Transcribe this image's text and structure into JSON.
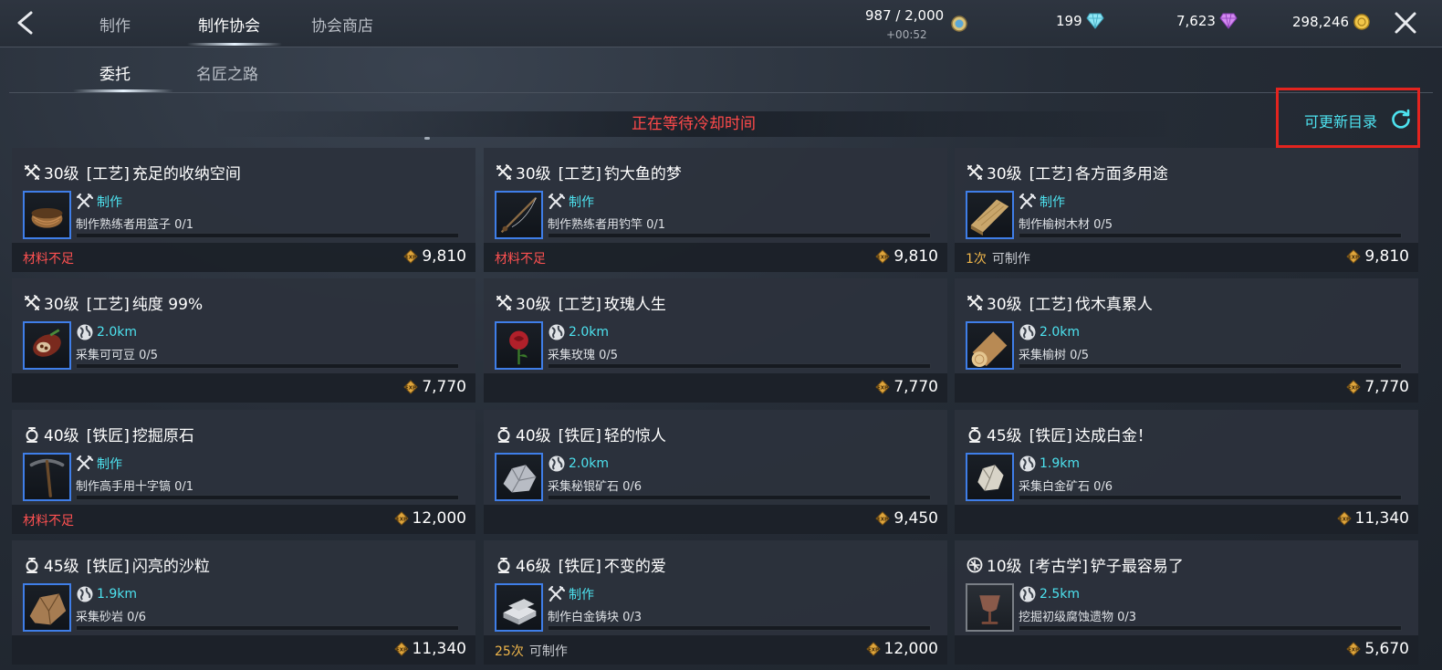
{
  "header": {
    "tabs": [
      "制作",
      "制作协会",
      "协会商店"
    ],
    "active_tab": "制作协会",
    "stamina": "987 / 2,000",
    "stamina_timer": "+00:52",
    "diamonds": "199",
    "gems": "7,623",
    "gold": "298,246"
  },
  "subtabs": [
    "委托",
    "名匠之路"
  ],
  "active_subtab": "委托",
  "cooldown_text": "正在等待冷却时间",
  "refresh_label": "可更新目录",
  "colors": {
    "accent": "#4de2ef",
    "warning": "#ff5151",
    "count": "#f0b64a",
    "highlight_box": "#e3241f"
  },
  "cards": [
    {
      "icon": "craft-icon",
      "level": "30级",
      "category": "[工艺]",
      "name": "充足的收纳空间",
      "tag_icon": "tools-icon",
      "tag": "制作",
      "desc": "制作熟练者用篮子 0/1",
      "status_type": "warn",
      "status": "材料不足",
      "count": "",
      "reward": "9,810",
      "thumb": "basket",
      "thumb_frame": "blue"
    },
    {
      "icon": "craft-icon",
      "level": "30级",
      "category": "[工艺]",
      "name": "钓大鱼的梦",
      "tag_icon": "tools-icon",
      "tag": "制作",
      "desc": "制作熟练者用钓竿 0/1",
      "status_type": "warn",
      "status": "材料不足",
      "count": "",
      "reward": "9,810",
      "thumb": "rod",
      "thumb_frame": "blue"
    },
    {
      "icon": "craft-icon",
      "level": "30级",
      "category": "[工艺]",
      "name": "各方面多用途",
      "tag_icon": "tools-icon",
      "tag": "制作",
      "desc": "制作榆树木材 0/5",
      "status_type": "count",
      "status": "可制作",
      "count": "1次",
      "reward": "9,810",
      "thumb": "plank",
      "thumb_frame": "blue"
    },
    {
      "icon": "craft-icon",
      "level": "30级",
      "category": "[工艺]",
      "name": "纯度 99%",
      "tag_icon": "globe-icon",
      "tag": "2.0km",
      "desc": "采集可可豆 0/5",
      "status_type": "none",
      "status": "",
      "count": "",
      "reward": "7,770",
      "thumb": "cocoa",
      "thumb_frame": "blue"
    },
    {
      "icon": "craft-icon",
      "level": "30级",
      "category": "[工艺]",
      "name": "玫瑰人生",
      "tag_icon": "globe-icon",
      "tag": "2.0km",
      "desc": "采集玫瑰 0/5",
      "status_type": "none",
      "status": "",
      "count": "",
      "reward": "7,770",
      "thumb": "rose",
      "thumb_frame": "blue"
    },
    {
      "icon": "craft-icon",
      "level": "30级",
      "category": "[工艺]",
      "name": "伐木真累人",
      "tag_icon": "globe-icon",
      "tag": "2.0km",
      "desc": "采集榆树 0/5",
      "status_type": "none",
      "status": "",
      "count": "",
      "reward": "7,770",
      "thumb": "log",
      "thumb_frame": "blue"
    },
    {
      "icon": "smith-icon",
      "level": "40级",
      "category": "[铁匠]",
      "name": "挖掘原石",
      "tag_icon": "tools-icon",
      "tag": "制作",
      "desc": "制作高手用十字镐 0/1",
      "status_type": "warn",
      "status": "材料不足",
      "count": "",
      "reward": "12,000",
      "thumb": "pickaxe",
      "thumb_frame": "blue"
    },
    {
      "icon": "smith-icon",
      "level": "40级",
      "category": "[铁匠]",
      "name": "轻的惊人",
      "tag_icon": "globe-icon",
      "tag": "2.0km",
      "desc": "采集秘银矿石 0/6",
      "status_type": "none",
      "status": "",
      "count": "",
      "reward": "9,450",
      "thumb": "mithril",
      "thumb_frame": "blue"
    },
    {
      "icon": "smith-icon",
      "level": "45级",
      "category": "[铁匠]",
      "name": "达成白金！",
      "tag_icon": "globe-icon",
      "tag": "1.9km",
      "desc": "采集白金矿石 0/6",
      "status_type": "none",
      "status": "",
      "count": "",
      "reward": "11,340",
      "thumb": "platinum",
      "thumb_frame": "blue"
    },
    {
      "icon": "smith-icon",
      "level": "45级",
      "category": "[铁匠]",
      "name": "闪亮的沙粒",
      "tag_icon": "globe-icon",
      "tag": "1.9km",
      "desc": "采集砂岩 0/6",
      "status_type": "none",
      "status": "",
      "count": "",
      "reward": "11,340",
      "thumb": "sandstone",
      "thumb_frame": "blue"
    },
    {
      "icon": "smith-icon",
      "level": "46级",
      "category": "[铁匠]",
      "name": "不变的爱",
      "tag_icon": "tools-icon",
      "tag": "制作",
      "desc": "制作白金铸块 0/3",
      "status_type": "count",
      "status": "可制作",
      "count": "25次",
      "reward": "12,000",
      "thumb": "ingot",
      "thumb_frame": "blue"
    },
    {
      "icon": "archaeology-icon",
      "level": "10级",
      "category": "[考古学]",
      "name": "铲子最容易了",
      "tag_icon": "globe-icon",
      "tag": "2.5km",
      "desc": "挖掘初级腐蚀遗物 0/3",
      "status_type": "none",
      "status": "",
      "count": "",
      "reward": "5,670",
      "thumb": "cup",
      "thumb_frame": "gray"
    }
  ]
}
